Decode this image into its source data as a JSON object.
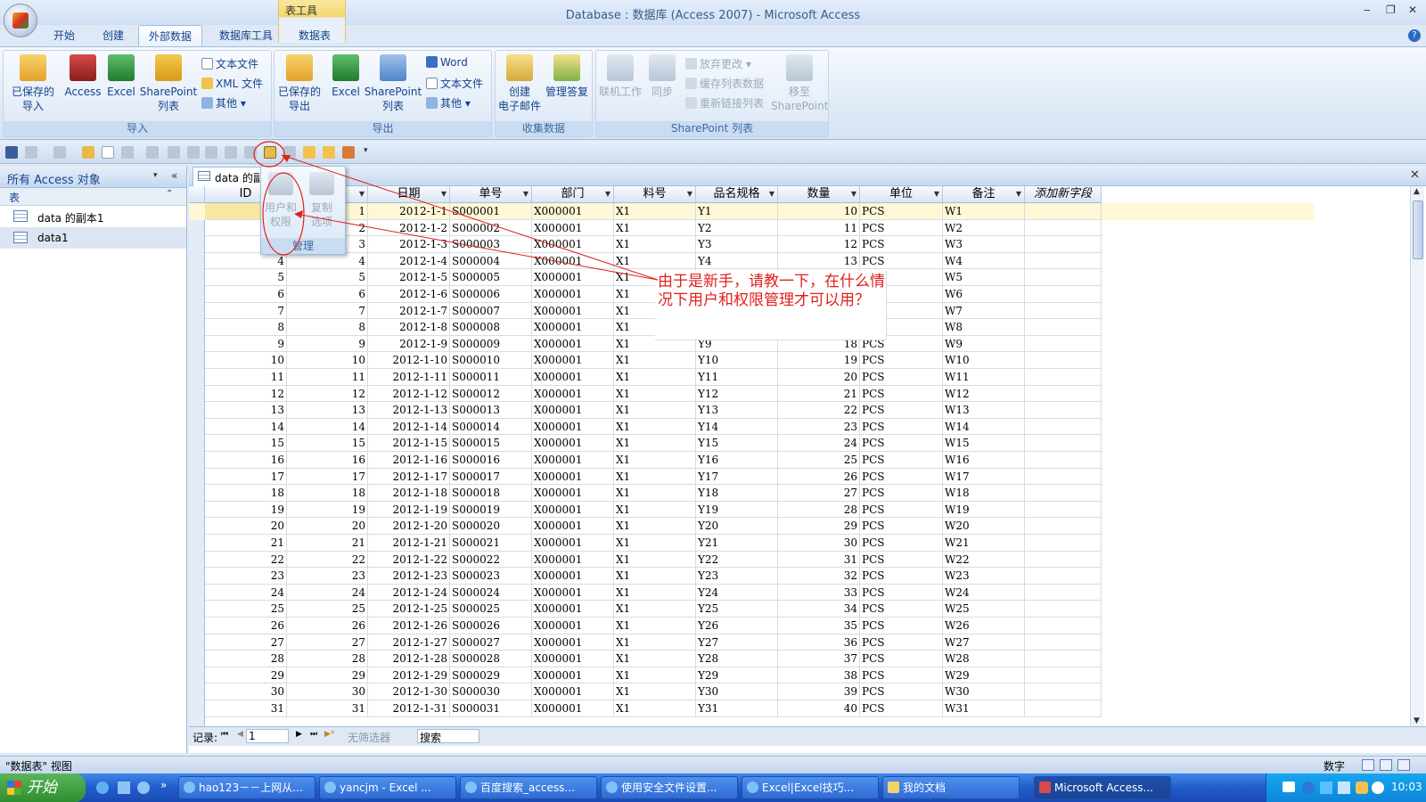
{
  "window": {
    "title": "Database : 数据库 (Access 2007) - Microsoft Access",
    "context_tab": "表工具",
    "min": "‒",
    "restore": "❐",
    "close": "✕",
    "help": "?"
  },
  "ribbon_tabs": [
    "开始",
    "创建",
    "外部数据",
    "数据库工具",
    "数据表"
  ],
  "ribbon": {
    "import": {
      "label": "导入",
      "saved": "已保存的\n导入",
      "access": "Access",
      "excel": "Excel",
      "sharepoint": "SharePoint\n列表",
      "text": "文本文件",
      "xml": "XML 文件",
      "other": "其他 ▾"
    },
    "export": {
      "label": "导出",
      "saved": "已保存的\n导出",
      "excel": "Excel",
      "sharepoint": "SharePoint\n列表",
      "word": "Word",
      "text": "文本文件",
      "other": "其他 ▾"
    },
    "collect": {
      "label": "收集数据",
      "create_email": "创建\n电子邮件",
      "manage_replies": "管理答复"
    },
    "sharepoint": {
      "label": "SharePoint 列表",
      "work_online": "联机工作",
      "sync": "同步",
      "discard": "放弃更改 ▾",
      "cache": "缓存列表数据",
      "relink": "重新链接列表",
      "move": "移至\nSharePoint"
    }
  },
  "nav": {
    "header": "所有 Access 对象",
    "section": "表",
    "items": [
      "data 的副本1",
      "data1"
    ]
  },
  "doc_tab": "data 的副",
  "popup": {
    "users": "用户和\n权限",
    "copy": "复制\n选项",
    "group": "管理"
  },
  "annotation": "由于是新手，请教一下，在什么情况下用户和权限管理才可以用？",
  "grid": {
    "columns": [
      "ID",
      "",
      "日期",
      "单号",
      "部门",
      "料号",
      "品名规格",
      "数量",
      "单位",
      "备注",
      "添加新字段"
    ],
    "rows": [
      [
        "",
        "1",
        "2012-1-1",
        "S000001",
        "X000001",
        "X1",
        "Y1",
        "10",
        "PCS",
        "W1"
      ],
      [
        "2",
        "2",
        "2012-1-2",
        "S000002",
        "X000001",
        "X1",
        "Y2",
        "11",
        "PCS",
        "W2"
      ],
      [
        "3",
        "3",
        "2012-1-3",
        "S000003",
        "X000001",
        "X1",
        "Y3",
        "12",
        "PCS",
        "W3"
      ],
      [
        "4",
        "4",
        "2012-1-4",
        "S000004",
        "X000001",
        "X1",
        "Y4",
        "13",
        "PCS",
        "W4"
      ],
      [
        "5",
        "5",
        "2012-1-5",
        "S000005",
        "X000001",
        "X1",
        "",
        "",
        "",
        "W5"
      ],
      [
        "6",
        "6",
        "2012-1-6",
        "S000006",
        "X000001",
        "X1",
        "",
        "",
        "",
        "W6"
      ],
      [
        "7",
        "7",
        "2012-1-7",
        "S000007",
        "X000001",
        "X1",
        "",
        "",
        "",
        "W7"
      ],
      [
        "8",
        "8",
        "2012-1-8",
        "S000008",
        "X000001",
        "X1",
        "",
        "",
        "",
        "W8"
      ],
      [
        "9",
        "9",
        "2012-1-9",
        "S000009",
        "X000001",
        "X1",
        "Y9",
        "18",
        "PCS",
        "W9"
      ],
      [
        "10",
        "10",
        "2012-1-10",
        "S000010",
        "X000001",
        "X1",
        "Y10",
        "19",
        "PCS",
        "W10"
      ],
      [
        "11",
        "11",
        "2012-1-11",
        "S000011",
        "X000001",
        "X1",
        "Y11",
        "20",
        "PCS",
        "W11"
      ],
      [
        "12",
        "12",
        "2012-1-12",
        "S000012",
        "X000001",
        "X1",
        "Y12",
        "21",
        "PCS",
        "W12"
      ],
      [
        "13",
        "13",
        "2012-1-13",
        "S000013",
        "X000001",
        "X1",
        "Y13",
        "22",
        "PCS",
        "W13"
      ],
      [
        "14",
        "14",
        "2012-1-14",
        "S000014",
        "X000001",
        "X1",
        "Y14",
        "23",
        "PCS",
        "W14"
      ],
      [
        "15",
        "15",
        "2012-1-15",
        "S000015",
        "X000001",
        "X1",
        "Y15",
        "24",
        "PCS",
        "W15"
      ],
      [
        "16",
        "16",
        "2012-1-16",
        "S000016",
        "X000001",
        "X1",
        "Y16",
        "25",
        "PCS",
        "W16"
      ],
      [
        "17",
        "17",
        "2012-1-17",
        "S000017",
        "X000001",
        "X1",
        "Y17",
        "26",
        "PCS",
        "W17"
      ],
      [
        "18",
        "18",
        "2012-1-18",
        "S000018",
        "X000001",
        "X1",
        "Y18",
        "27",
        "PCS",
        "W18"
      ],
      [
        "19",
        "19",
        "2012-1-19",
        "S000019",
        "X000001",
        "X1",
        "Y19",
        "28",
        "PCS",
        "W19"
      ],
      [
        "20",
        "20",
        "2012-1-20",
        "S000020",
        "X000001",
        "X1",
        "Y20",
        "29",
        "PCS",
        "W20"
      ],
      [
        "21",
        "21",
        "2012-1-21",
        "S000021",
        "X000001",
        "X1",
        "Y21",
        "30",
        "PCS",
        "W21"
      ],
      [
        "22",
        "22",
        "2012-1-22",
        "S000022",
        "X000001",
        "X1",
        "Y22",
        "31",
        "PCS",
        "W22"
      ],
      [
        "23",
        "23",
        "2012-1-23",
        "S000023",
        "X000001",
        "X1",
        "Y23",
        "32",
        "PCS",
        "W23"
      ],
      [
        "24",
        "24",
        "2012-1-24",
        "S000024",
        "X000001",
        "X1",
        "Y24",
        "33",
        "PCS",
        "W24"
      ],
      [
        "25",
        "25",
        "2012-1-25",
        "S000025",
        "X000001",
        "X1",
        "Y25",
        "34",
        "PCS",
        "W25"
      ],
      [
        "26",
        "26",
        "2012-1-26",
        "S000026",
        "X000001",
        "X1",
        "Y26",
        "35",
        "PCS",
        "W26"
      ],
      [
        "27",
        "27",
        "2012-1-27",
        "S000027",
        "X000001",
        "X1",
        "Y27",
        "36",
        "PCS",
        "W27"
      ],
      [
        "28",
        "28",
        "2012-1-28",
        "S000028",
        "X000001",
        "X1",
        "Y28",
        "37",
        "PCS",
        "W28"
      ],
      [
        "29",
        "29",
        "2012-1-29",
        "S000029",
        "X000001",
        "X1",
        "Y29",
        "38",
        "PCS",
        "W29"
      ],
      [
        "30",
        "30",
        "2012-1-30",
        "S000030",
        "X000001",
        "X1",
        "Y30",
        "39",
        "PCS",
        "W30"
      ],
      [
        "31",
        "31",
        "2012-1-31",
        "S000031",
        "X000001",
        "X1",
        "Y31",
        "40",
        "PCS",
        "W31"
      ]
    ]
  },
  "recbar": {
    "label": "记录:",
    "first": "⏮",
    "prev": "◀",
    "current": "1",
    "next": "▶",
    "last": "⏭",
    "new": "▶*",
    "filter": "无筛选器",
    "search": "搜索"
  },
  "status": {
    "view": "\"数据表\" 视图",
    "mode": "数字"
  },
  "taskbar": {
    "start": "开始",
    "items": [
      "hao123－－上网从...",
      "yancjm - Excel ...",
      "百度搜索_access...",
      "使用安全文件设置...",
      "Excel|Excel技巧...",
      "我的文档",
      "Microsoft Access..."
    ],
    "clock": "10:03"
  },
  "colors": {
    "annotation": "#e0201c",
    "ribbon_text": "#15428b"
  }
}
